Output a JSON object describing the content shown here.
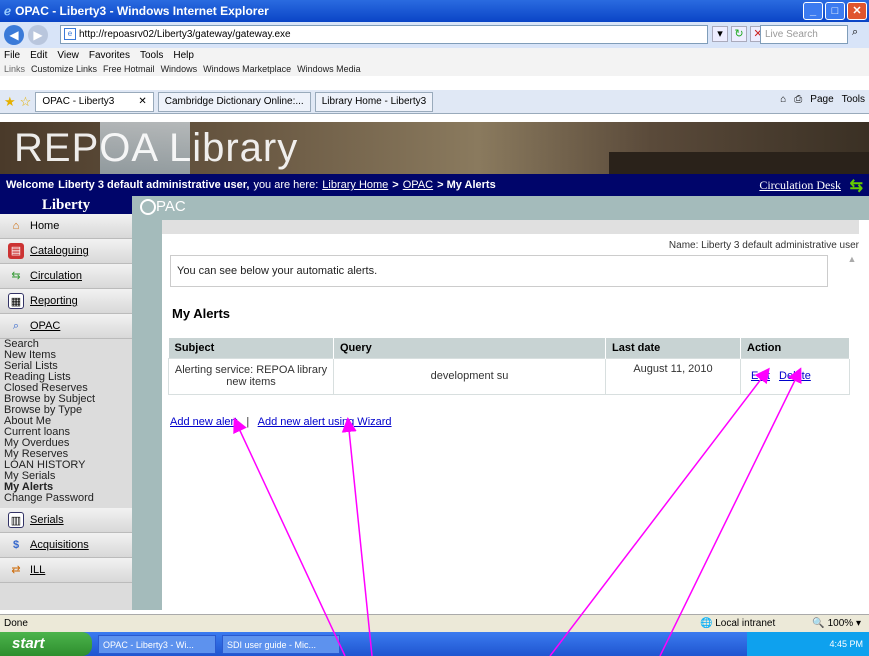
{
  "window": {
    "title": "OPAC - Liberty3 - Windows Internet Explorer",
    "url": "http://repoasrv02/Liberty3/gateway/gateway.exe",
    "search_placeholder": "Live Search",
    "menu": [
      "File",
      "Edit",
      "View",
      "Favorites",
      "Tools",
      "Help"
    ],
    "links_label": "Links",
    "links": [
      "Customize Links",
      "Free Hotmail",
      "Windows",
      "Windows Marketplace",
      "Windows Media"
    ],
    "tabs": [
      "OPAC - Liberty3",
      "Cambridge Dictionary Online:...",
      "Library Home - Liberty3"
    ],
    "tab_tools": [
      "Page",
      "Tools"
    ]
  },
  "banner": {
    "title": "REPOA Library"
  },
  "bluebar": {
    "welcome_prefix": "Welcome",
    "user": "Liberty 3 default administrative user,",
    "here": "you are here:",
    "crumbs": [
      "Library Home",
      "OPAC"
    ],
    "separator": ">",
    "current": "> My Alerts",
    "circulation_link": "Circulation Desk"
  },
  "sidebar": {
    "brand": "Liberty",
    "modules_top": [
      "Home",
      "Cataloguing",
      "Circulation",
      "Reporting",
      "OPAC"
    ],
    "opac_links": [
      "Search",
      "New Items",
      "Serial Lists",
      "Reading Lists",
      "Closed Reserves",
      "Browse by Subject",
      "Browse by Type",
      "About Me",
      "Current loans",
      "My Overdues",
      "My Reserves",
      "LOAN HISTORY",
      "My Serials",
      "My Alerts",
      "Change Password"
    ],
    "modules_bottom": [
      "Serials",
      "Acquisitions",
      "ILL"
    ]
  },
  "opac_header": "PAC",
  "content": {
    "user_name": "Name: Liberty 3 default administrative user",
    "info": "You can see below your automatic alerts.",
    "heading": "My Alerts",
    "columns": [
      "Subject",
      "Query",
      "Last date",
      "Action"
    ],
    "rows": [
      {
        "subject": "Alerting service: REPOA library new items",
        "query": "development su",
        "date": "August 11, 2010",
        "edit": "Edit",
        "delete": "Delete"
      }
    ],
    "add_new": "Add new alert",
    "add_wizard": "Add new alert using Wizard"
  },
  "status": {
    "text": "Done",
    "zone": "Local intranet",
    "zoom": "100%"
  },
  "taskbar": {
    "start": "start",
    "tasks": [
      "OPAC - Liberty3 - Wi...",
      "SDI user guide - Mic..."
    ],
    "clock": "4:45 PM"
  },
  "annotation": {
    "arrow_color": "#ff00ff"
  }
}
